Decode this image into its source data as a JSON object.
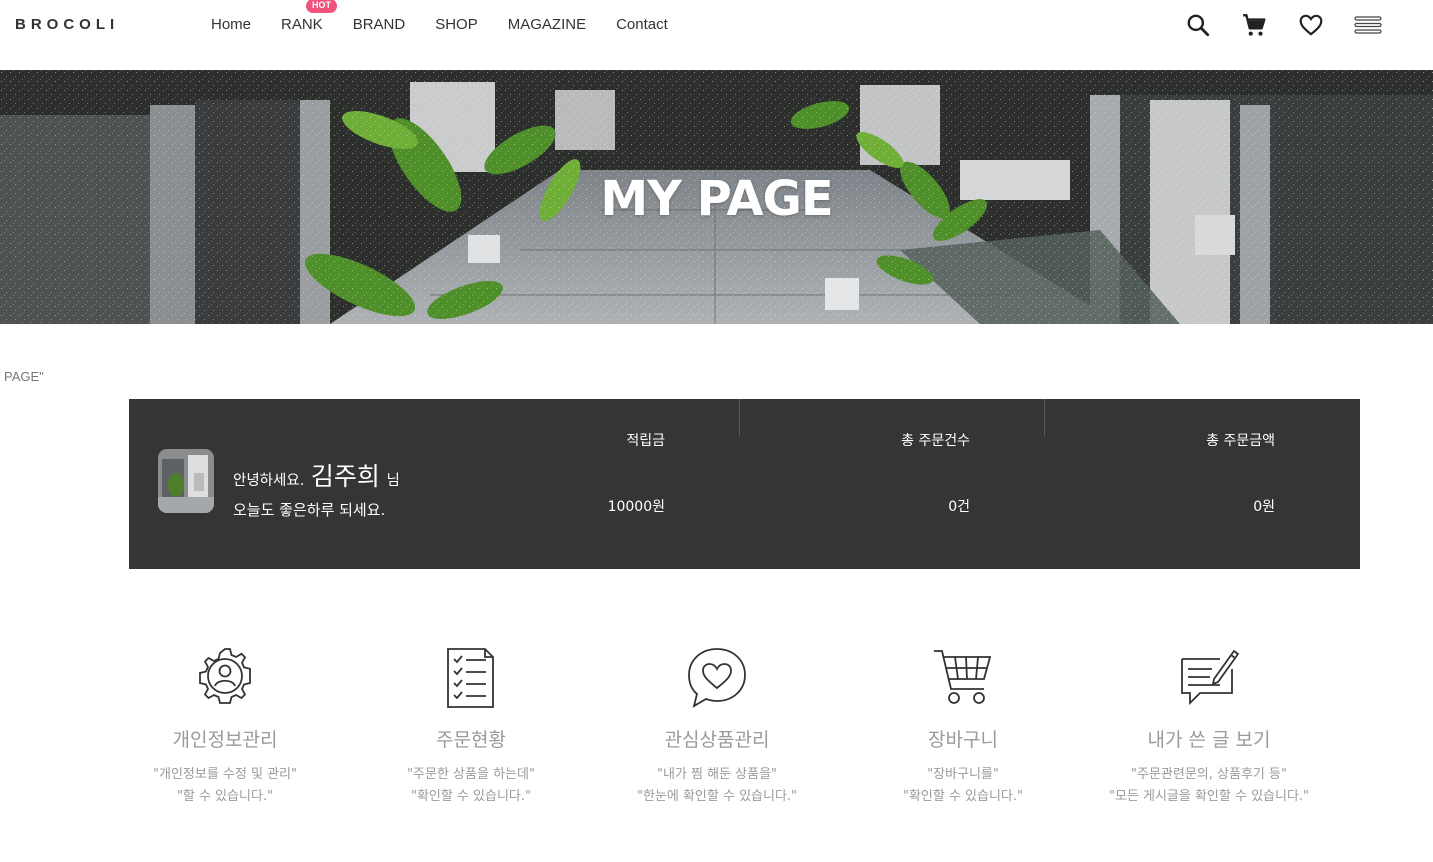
{
  "header": {
    "logo": "BROCOLI",
    "nav": [
      {
        "label": "Home"
      },
      {
        "label": "RANK",
        "badge": "HOT"
      },
      {
        "label": "BRAND"
      },
      {
        "label": "SHOP"
      },
      {
        "label": "MAGAZINE"
      },
      {
        "label": "Contact"
      }
    ],
    "icons": [
      "search-icon",
      "cart-icon",
      "heart-icon",
      "menu-icon"
    ]
  },
  "hero": {
    "title": "MY PAGE"
  },
  "breadcrumb": "Y PAGE\"",
  "summary": {
    "greeting_prefix": "안녕하세요.",
    "user_name": "김주희",
    "greeting_suffix": "님",
    "greeting_line2": "오늘도 좋은하루 되세요.",
    "stats": [
      {
        "label": "적립금",
        "value": "10000원"
      },
      {
        "label": "총 주문건수",
        "value": "0건"
      },
      {
        "label": "총 주문금액",
        "value": "0원"
      }
    ]
  },
  "menu": [
    {
      "icon": "profile-gear-icon",
      "title": "개인정보관리",
      "desc1": "\"개인정보를 수정 및 관리\"",
      "desc2": "\"할 수 있습니다.\""
    },
    {
      "icon": "order-checklist-icon",
      "title": "주문현황",
      "desc1": "\"주문한 상품을 하는데\"",
      "desc2": "\"확인할 수 있습니다.\""
    },
    {
      "icon": "heart-chat-icon",
      "title": "관심상품관리",
      "desc1": "\"내가 찜 해둔 상품을\"",
      "desc2": "\"한눈에 확인할 수 있습니다.\""
    },
    {
      "icon": "shopping-cart-icon",
      "title": "장바구니",
      "desc1": "\"장바구니를\"",
      "desc2": "\"확인할 수 있습니다.\""
    },
    {
      "icon": "write-post-icon",
      "title": "내가 쓴 글 보기",
      "desc1": "\"주문관련문의, 상품후기 등\"",
      "desc2": "\"모든 게시글을 확인할 수 있습니다.\""
    }
  ],
  "colors": {
    "accent_hot": "#f2537a",
    "summary_bg": "#353535",
    "menu_text": "#9a9a9a"
  }
}
